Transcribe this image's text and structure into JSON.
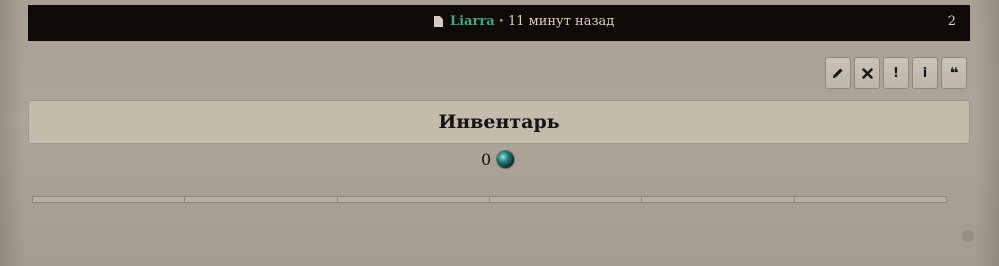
{
  "post": {
    "author": "Liarra",
    "separator": "•",
    "time": "11 минут назад",
    "number": "2"
  },
  "actions": [
    {
      "name": "edit",
      "icon": "pencil-icon"
    },
    {
      "name": "delete",
      "icon": "close-icon"
    },
    {
      "name": "report",
      "icon": "exclamation-icon",
      "label": "!"
    },
    {
      "name": "info",
      "icon": "info-icon",
      "label": "i"
    },
    {
      "name": "quote",
      "icon": "quote-icon",
      "label": "❝"
    }
  ],
  "inventory": {
    "title": "Инвентарь",
    "currency_amount": "0",
    "currency_icon": "orb-icon",
    "slot_count": 6
  },
  "colors": {
    "header_bg": "#0f0a06",
    "author": "#3ea882",
    "page_bg": "#aaa397"
  }
}
